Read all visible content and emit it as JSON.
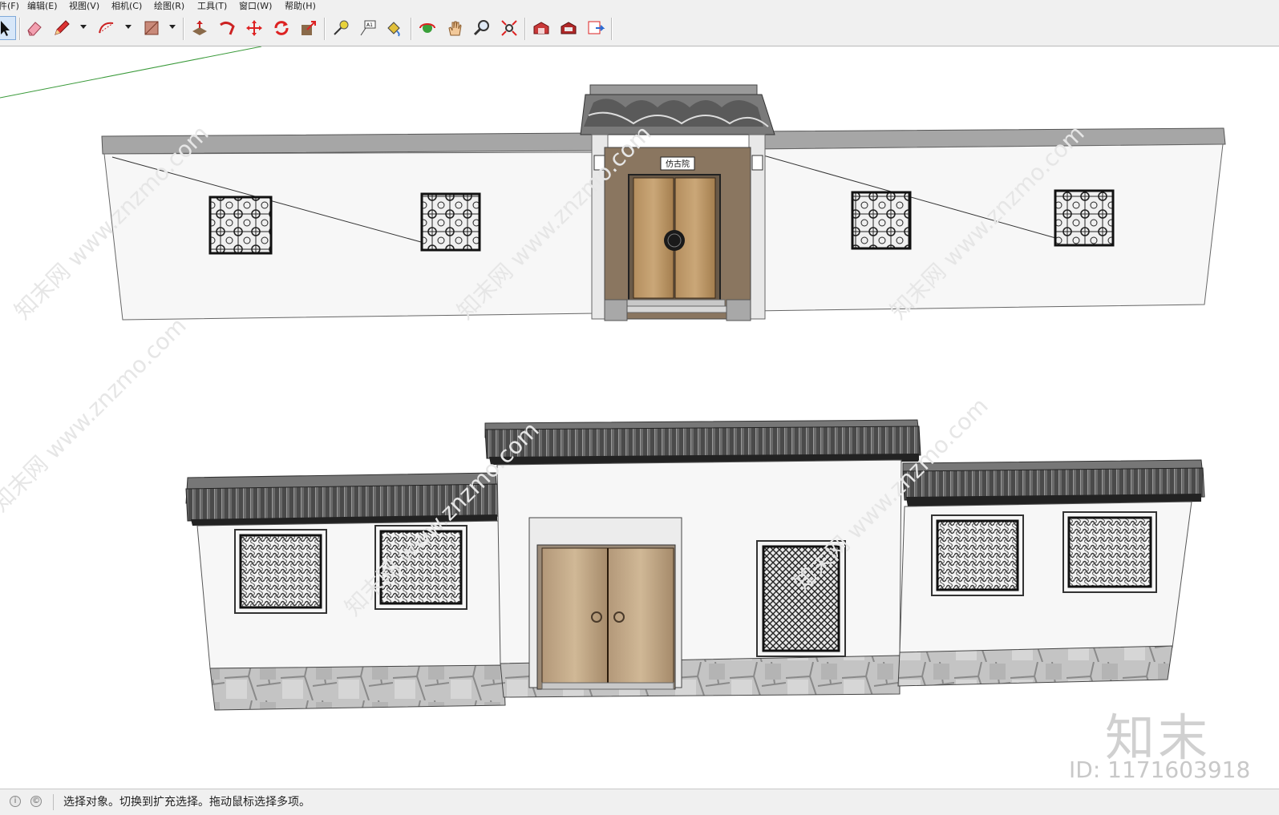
{
  "menu": [
    {
      "label": "件(F)"
    },
    {
      "label": "编辑(E)"
    },
    {
      "label": "视图(V)"
    },
    {
      "label": "相机(C)"
    },
    {
      "label": "绘图(R)"
    },
    {
      "label": "工具(T)"
    },
    {
      "label": "窗口(W)"
    },
    {
      "label": "帮助(H)"
    }
  ],
  "toolbar": {
    "tools": [
      {
        "name": "select-tool",
        "icon": "arrow-cursor-icon"
      },
      {
        "name": "eraser-tool",
        "icon": "eraser-icon"
      },
      {
        "name": "pencil-tool",
        "icon": "pencil-icon"
      },
      {
        "name": "arc-tool",
        "icon": "arc-icon"
      },
      {
        "name": "rectangle-tool",
        "icon": "rectangle-icon"
      },
      {
        "name": "push-pull-tool",
        "icon": "push-pull-icon"
      },
      {
        "name": "follow-me-tool",
        "icon": "follow-me-icon"
      },
      {
        "name": "move-tool",
        "icon": "move-arrows-icon"
      },
      {
        "name": "rotate-tool",
        "icon": "rotate-icon"
      },
      {
        "name": "scale-tool",
        "icon": "scale-icon"
      },
      {
        "name": "tape-measure-tool",
        "icon": "tape-measure-icon"
      },
      {
        "name": "text-tool",
        "icon": "text-label-icon"
      },
      {
        "name": "paint-bucket-tool",
        "icon": "paint-bucket-icon"
      },
      {
        "name": "orbit-tool",
        "icon": "orbit-icon"
      },
      {
        "name": "pan-tool",
        "icon": "hand-icon"
      },
      {
        "name": "zoom-tool",
        "icon": "magnifier-icon"
      },
      {
        "name": "zoom-extents-tool",
        "icon": "zoom-extents-icon"
      },
      {
        "name": "warehouse-tool",
        "icon": "warehouse-icon"
      },
      {
        "name": "extension-warehouse-tool",
        "icon": "extension-warehouse-icon"
      },
      {
        "name": "send-to-layout-tool",
        "icon": "layout-icon"
      }
    ]
  },
  "scene": {
    "plaque_text": "仿古院",
    "colors": {
      "wall": "#f7f7f7",
      "roof": "#5a5a5a",
      "door": "#b08a5a",
      "frame": "#8a7660",
      "stone": "#bdbdbd",
      "axis_green": "#3a9a3a"
    }
  },
  "status": {
    "text": "选择对象。切换到扩充选择。拖动鼠标选择多项。"
  },
  "watermark": {
    "brand": "知末",
    "id": "ID: 1171603918",
    "diagonal": "知末网 www.znzmo.com"
  }
}
